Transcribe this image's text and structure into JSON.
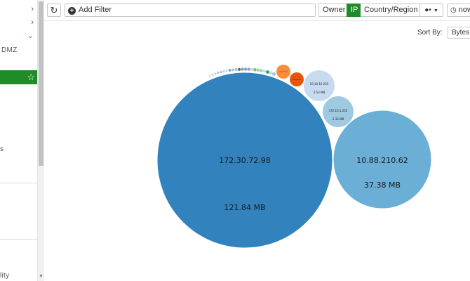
{
  "sidebar": {
    "menu_text_1": "DMZ",
    "menu_text_2": "s",
    "menu_text_3": "lity"
  },
  "toolbar": {
    "add_filter_label": "Add Filter",
    "tabs": [
      "Owner",
      "IP",
      "Country/Region"
    ],
    "active_tab": "IP",
    "time_label": "now"
  },
  "sort": {
    "label": "Sort By:",
    "value": "Bytes"
  },
  "colors": {
    "accent_green": "#1f8c28",
    "bubble_primary": "#3182bd",
    "bubble_secondary": "#6baed6",
    "bubble_light": "#c6dbef",
    "bubble_orange": "#fd8d3c",
    "bubble_orange_dark": "#e6550d"
  },
  "bubbles": [
    {
      "ip": "172.30.72.98",
      "bytes": "121.84 MB"
    },
    {
      "ip": "10.88.210.62",
      "bytes": "37.38 MB"
    },
    {
      "ip": "10.10.10.255",
      "bytes": "2.53 MB"
    },
    {
      "ip": "172.16.1.255",
      "bytes": "2.33 MB"
    }
  ]
}
